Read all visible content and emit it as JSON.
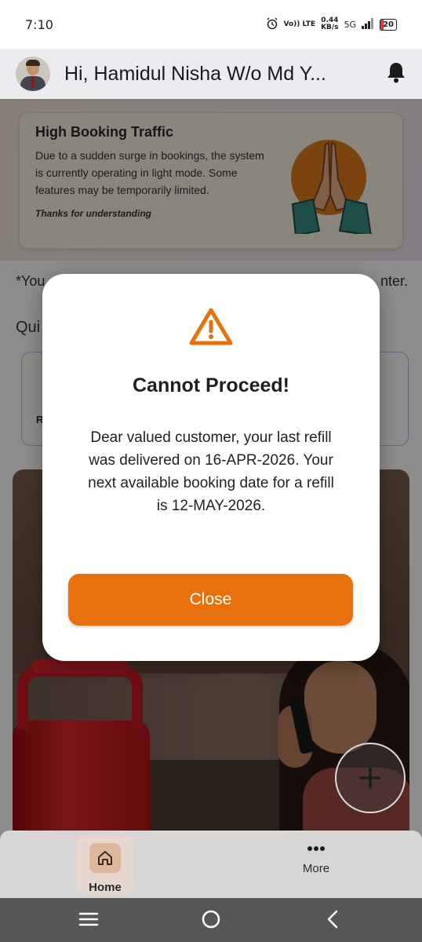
{
  "status_bar": {
    "time": "7:10",
    "network_speed_value": "0.44",
    "network_speed_unit": "KB/s",
    "volte_label": "Vo)) LTE",
    "network": "5G",
    "battery": "20"
  },
  "header": {
    "greeting": "Hi, Hamidul Nisha W/o Md Y..."
  },
  "banner": {
    "title": "High Booking Traffic",
    "text": "Due to a sudden surge in bookings, the system is currently operating in light mode. Some features may be temporarily limited.",
    "thanks": "Thanks for understanding"
  },
  "notice": {
    "prefix": "*You",
    "suffix": "nter."
  },
  "quick": {
    "title_fragment": "Qui",
    "card_label_fragment": "R"
  },
  "modal": {
    "title": "Cannot Proceed!",
    "message": "Dear valued customer, your last refill was delivered on 16-APR-2026. Your next available booking date for a refill is 12-MAY-2026.",
    "button": "Close"
  },
  "bottom_nav": {
    "items": [
      {
        "label": "Home",
        "icon": "home-icon",
        "active": true
      },
      {
        "label": "More",
        "icon": "more-icon",
        "active": false
      }
    ]
  },
  "colors": {
    "accent": "#e8700d",
    "warning_icon": "#e8700d"
  }
}
